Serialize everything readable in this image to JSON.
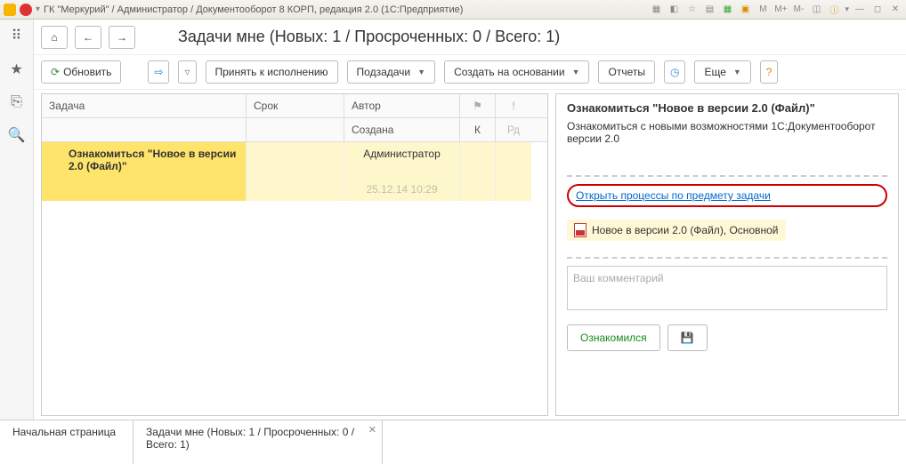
{
  "titlebar": {
    "text": "ГК \"Меркурий\" / Администратор / Документооборот 8 КОРП, редакция 2.0  (1С:Предприятие)",
    "right_labels": [
      "M",
      "M+",
      "M-"
    ]
  },
  "page_title": "Задачи мне (Новых: 1 / Просроченных: 0 / Всего: 1)",
  "toolbar": {
    "refresh": "Обновить",
    "accept": "Принять к исполнению",
    "subtasks": "Подзадачи",
    "create_based": "Создать на основании",
    "reports": "Отчеты",
    "more": "Еще"
  },
  "grid": {
    "headers": {
      "task": "Задача",
      "due": "Срок",
      "author": "Автор",
      "flag": "⚑",
      "excl": "!"
    },
    "subheaders": {
      "created": "Создана",
      "k": "К",
      "rd": "Рд"
    },
    "row": {
      "title": "Ознакомиться \"Новое в версии 2.0 (Файл)\"",
      "author": "Администратор",
      "created": "25.12.14 10:29"
    }
  },
  "detail": {
    "title": "Ознакомиться \"Новое в версии 2.0 (Файл)\"",
    "desc": "Ознакомиться с новыми возможностями 1С:Документооборот версии 2.0",
    "link": "Открыть процессы по предмету задачи",
    "attachment": "Новое в версии 2.0 (Файл), Основной",
    "comment_placeholder": "Ваш комментарий",
    "ok_button": "Ознакомился"
  },
  "tabs": {
    "start": "Начальная страница",
    "tasks": "Задачи мне (Новых: 1 / Просроченных: 0 / Всего: 1)"
  }
}
